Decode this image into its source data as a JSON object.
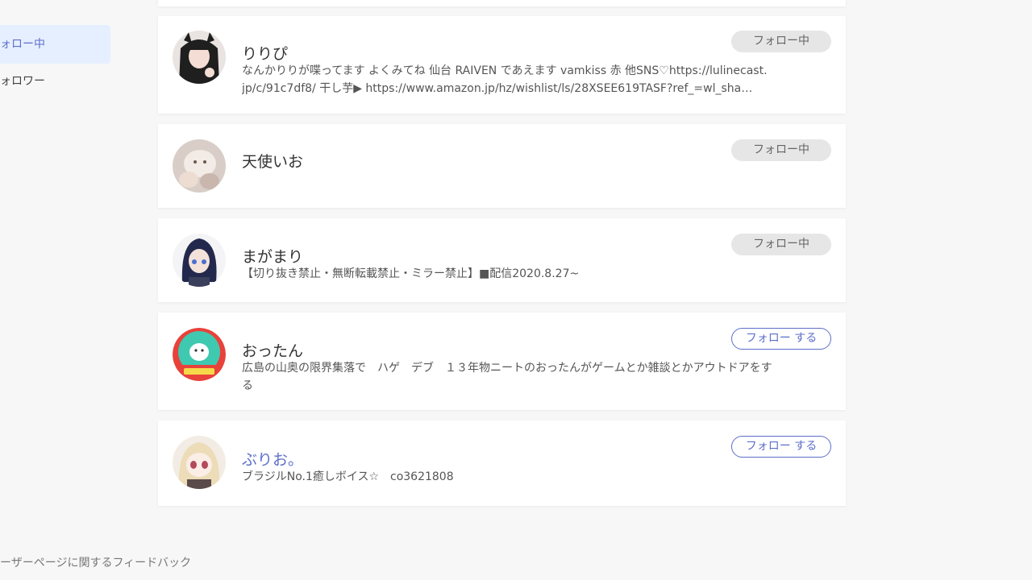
{
  "sidebar": {
    "active_label": "フォロー中",
    "other_label": "フォロワー"
  },
  "users": [
    {
      "name": "りりぴ",
      "description_line1": "なんかりりが喋ってます よくみてね 仙台 RAIVEN であえます vamkiss 赤 他SNS♡https://lulinecast.",
      "description_line2": "jp/c/91c7df8/ 干し芋▶ https://www.amazon.jp/hz/wishlist/ls/28XSEE619TASF?ref_=wl_sha…",
      "button": "フォロー中",
      "following": true,
      "avatar_color": "#2b2b2b"
    },
    {
      "name": "天使いお",
      "description_line1": "",
      "description_line2": "",
      "button": "フォロー中",
      "following": true,
      "avatar_color": "#d9cfc6"
    },
    {
      "name": "まがまり",
      "description_line1": "【切り抜き禁止・無断転載禁止・ミラー禁止】■配信2020.8.27~",
      "description_line2": "",
      "button": "フォロー中",
      "following": true,
      "avatar_color": "#2f3a66"
    },
    {
      "name": "おったん",
      "description_line1": "広島の山奥の限界集落で　ハゲ　デブ　１３年物ニートのおったんがゲームとか雑談とかアウトドアをす",
      "description_line2": "る",
      "button": "フォロー する",
      "following": false,
      "avatar_color": "#e8423a"
    },
    {
      "name": "ぶりお。",
      "description_line1": "ブラジルNo.1癒しボイス☆　co3621808",
      "description_line2": "",
      "button": "フォロー する",
      "following": false,
      "avatar_color": "#e9dcc0"
    }
  ],
  "footer": {
    "feedback_link": "ユーザーページに関するフィードバック"
  },
  "colors": {
    "accent": "#5d6fc9",
    "background": "#f7f7f7"
  }
}
